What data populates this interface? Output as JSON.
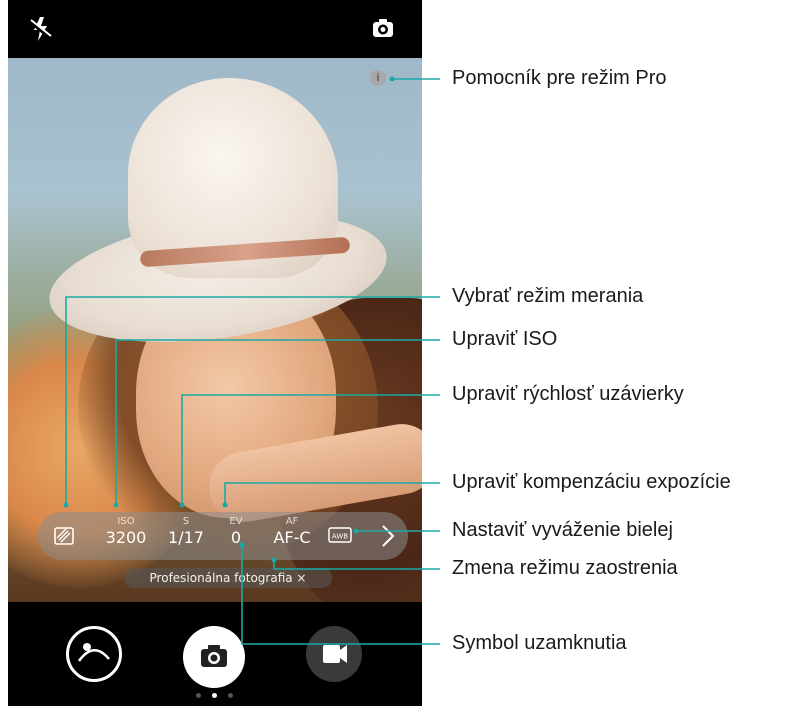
{
  "camera": {
    "pro_controls": [
      {
        "id": "metering",
        "label": "",
        "value": ""
      },
      {
        "id": "iso",
        "label": "ISO",
        "value": "3200"
      },
      {
        "id": "shutter",
        "label": "S",
        "value": "1/17"
      },
      {
        "id": "ev",
        "label": "EV",
        "value": "0"
      },
      {
        "id": "af",
        "label": "AF",
        "value": "AF-C"
      },
      {
        "id": "wb",
        "label": "AWB",
        "value": ""
      }
    ],
    "mode_pill": "Profesionálna fotografia ×",
    "help_icon_text": "i",
    "icons": {
      "flash": "flash-off-icon",
      "switch": "camera-switch-icon",
      "gallery": "gallery-icon",
      "shutter": "camera-icon",
      "video": "video-icon",
      "next": "chevron-right-icon"
    },
    "accent_color": "#1aa9a4"
  },
  "callouts": {
    "pro_help": "Pomocník pre režim Pro",
    "metering": "Vybrať režim merania",
    "iso": "Upraviť ISO",
    "shutter": "Upraviť rýchlosť uzávierky",
    "ev": "Upraviť kompenzáciu expozície",
    "wb": "Nastaviť vyváženie bielej",
    "focus": "Zmena režimu zaostrenia",
    "lock": "Symbol uzamknutia"
  }
}
